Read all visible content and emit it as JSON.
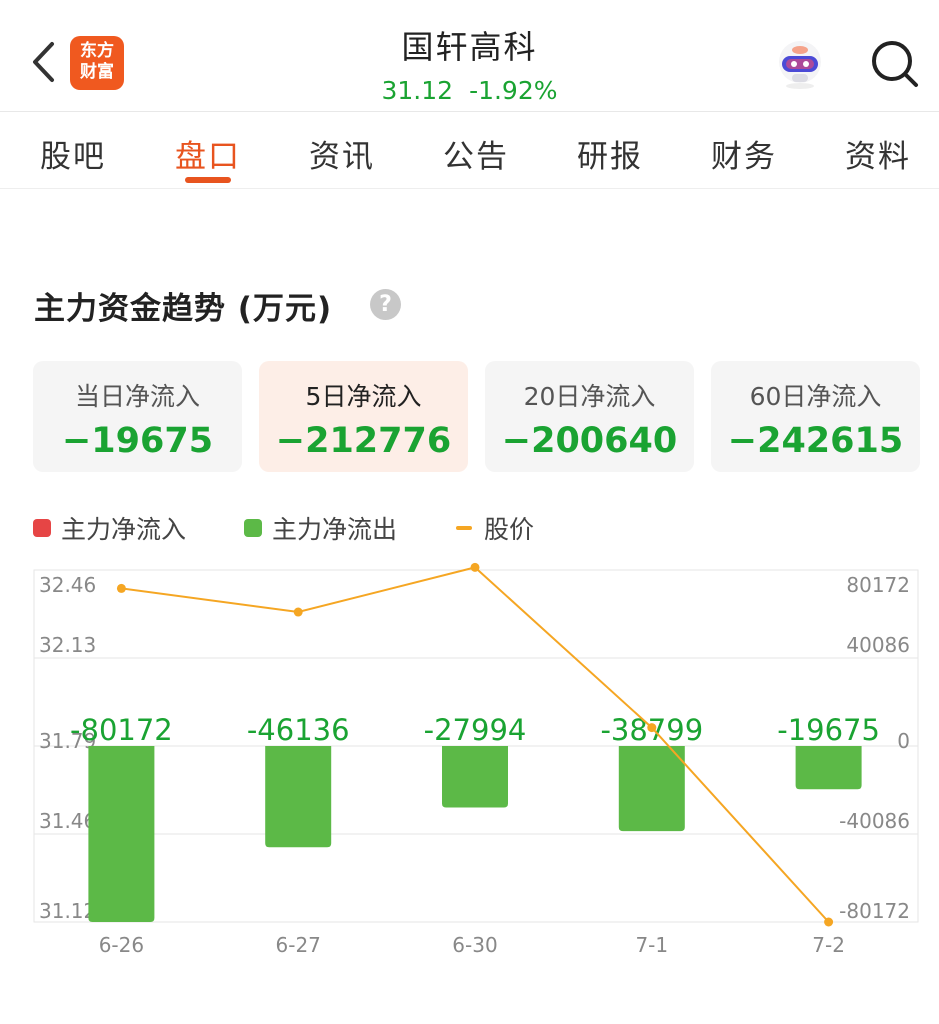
{
  "header": {
    "logo_line1": "东方",
    "logo_line2": "财富",
    "stock_name": "国轩高科",
    "price": "31.12",
    "change_pct": "-1.92%",
    "icons": [
      "back-arrow-icon",
      "robot-avatar-icon",
      "search-icon"
    ]
  },
  "tabs": [
    {
      "label": "股吧"
    },
    {
      "label": "盘口",
      "active": true
    },
    {
      "label": "资讯"
    },
    {
      "label": "公告"
    },
    {
      "label": "研报"
    },
    {
      "label": "财务"
    },
    {
      "label": "资料"
    }
  ],
  "section": {
    "title": "主力资金趋势 (万元)",
    "help": "?"
  },
  "cards": [
    {
      "label": "当日净流入",
      "value": "−19675"
    },
    {
      "label": "5日净流入",
      "value": "−212776",
      "active": true
    },
    {
      "label": "20日净流入",
      "value": "−200640"
    },
    {
      "label": "60日净流入",
      "value": "−242615"
    }
  ],
  "legend": {
    "inflow": "主力净流入",
    "outflow": "主力净流出",
    "price": "股价"
  },
  "colors": {
    "accent": "#e8541f",
    "inflow": "#e64545",
    "outflow": "#5cb947",
    "price_line": "#f5a623",
    "down_text": "#1aa332"
  },
  "chart_data": {
    "type": "bar",
    "categories": [
      "6-26",
      "6-27",
      "6-30",
      "7-1",
      "7-2"
    ],
    "series": [
      {
        "name": "主力净流出",
        "type": "bar",
        "values": [
          -80172,
          -46136,
          -27994,
          -38799,
          -19675
        ]
      },
      {
        "name": "股价",
        "type": "line",
        "values": [
          32.39,
          32.3,
          32.47,
          31.86,
          31.12
        ]
      }
    ],
    "bar_labels": [
      "-80172",
      "-46136",
      "-27994",
      "-38799",
      "-19675"
    ],
    "left_axis": {
      "ticks": [
        "32.46",
        "32.13",
        "31.79",
        "31.46",
        "31.12"
      ],
      "range": [
        31.12,
        32.46
      ]
    },
    "right_axis": {
      "ticks": [
        "80172",
        "40086",
        "0",
        "-40086",
        "-80172"
      ],
      "range": [
        -80172,
        80172
      ]
    },
    "grid": true
  }
}
